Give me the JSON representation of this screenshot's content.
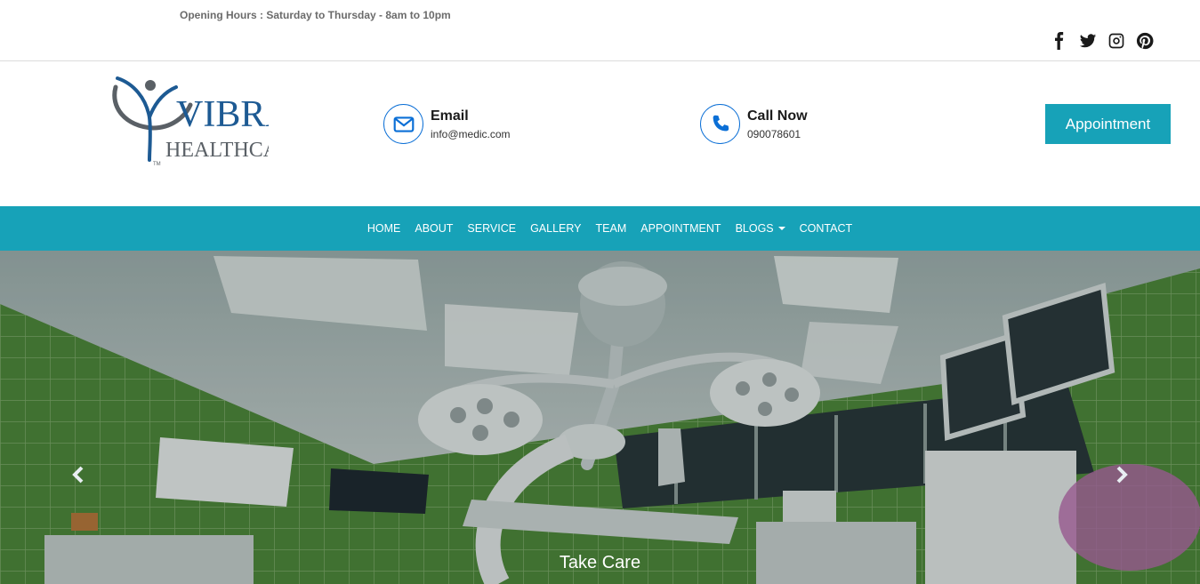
{
  "topbar": {
    "hours": "Opening Hours : Saturday to Thursday - 8am to 10pm",
    "social": [
      "facebook-icon",
      "twitter-icon",
      "instagram-icon",
      "pinterest-icon"
    ]
  },
  "header": {
    "logo": {
      "line1": "VIBRA",
      "line2": "HEALTHCARE",
      "tm": "TM"
    },
    "email": {
      "title": "Email",
      "value": "info@medic.com",
      "icon": "envelope-icon"
    },
    "call": {
      "title": "Call Now",
      "value": "090078601",
      "icon": "phone-icon"
    },
    "appointment_label": "Appointment"
  },
  "nav": {
    "items": [
      {
        "label": "HOME"
      },
      {
        "label": "ABOUT"
      },
      {
        "label": "SERVICE"
      },
      {
        "label": "GALLERY"
      },
      {
        "label": "TEAM"
      },
      {
        "label": "APPOINTMENT"
      },
      {
        "label": "BLOGS"
      },
      {
        "label": "CONTACT"
      }
    ]
  },
  "hero": {
    "caption": "Take Care"
  },
  "colors": {
    "accent": "#17a2b8",
    "icon_blue": "#0b6fd6",
    "logo_blue": "#1d5a93",
    "logo_gray": "#5a6066"
  }
}
